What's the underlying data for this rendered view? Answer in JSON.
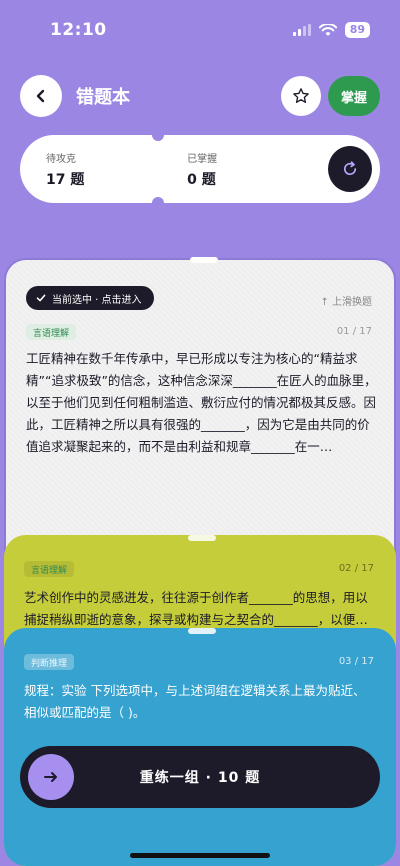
{
  "status_bar": {
    "time": "12:10",
    "battery": "89"
  },
  "header": {
    "title": "错题本",
    "master_label": "掌握"
  },
  "stats": {
    "pending_label": "待攻克",
    "pending_value": "17 题",
    "mastered_label": "已掌握",
    "mastered_value": "0 题"
  },
  "card1": {
    "selected_label": "当前选中 · 点击进入",
    "swipe_hint": "↑ 上滑换题",
    "tag": "言语理解",
    "counter": "01 / 17",
    "text": "工匠精神在数千年传承中，早已形成以专注为核心的“精益求精”“追求极致”的信念，这种信念深深_______在匠人的血脉里，以至于他们见到任何粗制滥造、敷衍应付的情况都极其反感。因此，工匠精神之所以具有很强的_______，因为它是由共同的价值追求凝聚起来的，而不是由利益和规章_______在一…"
  },
  "card2": {
    "tag": "言语理解",
    "counter": "02 / 17",
    "text": "艺术创作中的灵感迸发，往往源于创作者_______的思想，用以捕捉稍纵即逝的意象，探寻或构建与之契合的_______，以便…"
  },
  "card3": {
    "tag": "判断推理",
    "counter": "03 / 17",
    "text": "规程：实验 下列选项中，与上述词组在逻辑关系上最为贴近、相似或匹配的是（ )。"
  },
  "practice": {
    "label": "重练一组 · 10 题"
  },
  "colors": {
    "background": "#9b86e3",
    "card_dark": "#1d1b29",
    "master_green": "#2e9a4f",
    "card2_yellow": "#c6cd3b",
    "card3_blue": "#36a2cf",
    "go_button": "#a78ff0"
  }
}
